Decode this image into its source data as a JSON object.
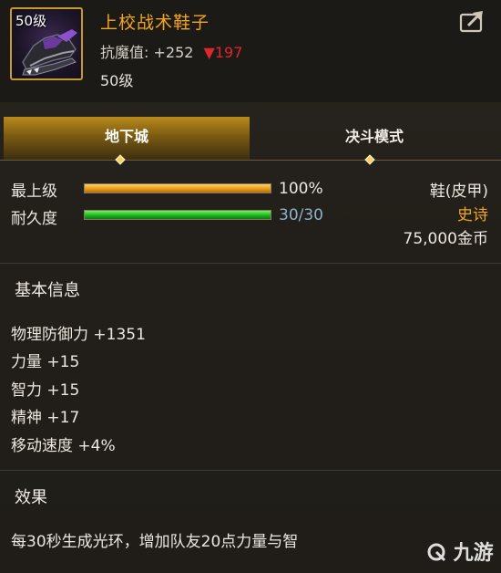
{
  "header": {
    "icon_level_badge": "50级",
    "item_name": "上校战术鞋子",
    "resist_label": "抗魔值:",
    "resist_value": "+252",
    "resist_diff": "▼197",
    "level_text": "50级",
    "share_icon": "share-icon"
  },
  "tabs": [
    {
      "label": "地下城",
      "active": true
    },
    {
      "label": "决斗模式",
      "active": false
    }
  ],
  "stats": {
    "top_level_label": "最上级",
    "top_level_percent": "100%",
    "top_level_fraction": 1.0,
    "durability_label": "耐久度",
    "durability_value": "30/30",
    "durability_fraction": 1.0
  },
  "item_info": {
    "type": "鞋(皮甲)",
    "rarity": "史诗",
    "price": "75,000金币"
  },
  "basic_info": {
    "title": "基本信息",
    "attributes": [
      "物理防御力 +1351",
      "力量 +15",
      "智力 +15",
      "精神 +17",
      "移动速度 +4%"
    ]
  },
  "effect": {
    "title": "效果",
    "text": "每30秒生成光环，增加队友20点力量与智"
  },
  "watermark": {
    "text": "九游",
    "icon": "jiuyou-logo-icon"
  },
  "colors": {
    "item_name": "#f2a51f",
    "rarity": "#f2a51f",
    "resist_down": "#e0262a",
    "durability_text": "#8fb0cc",
    "active_tab": "#b88a1c"
  }
}
